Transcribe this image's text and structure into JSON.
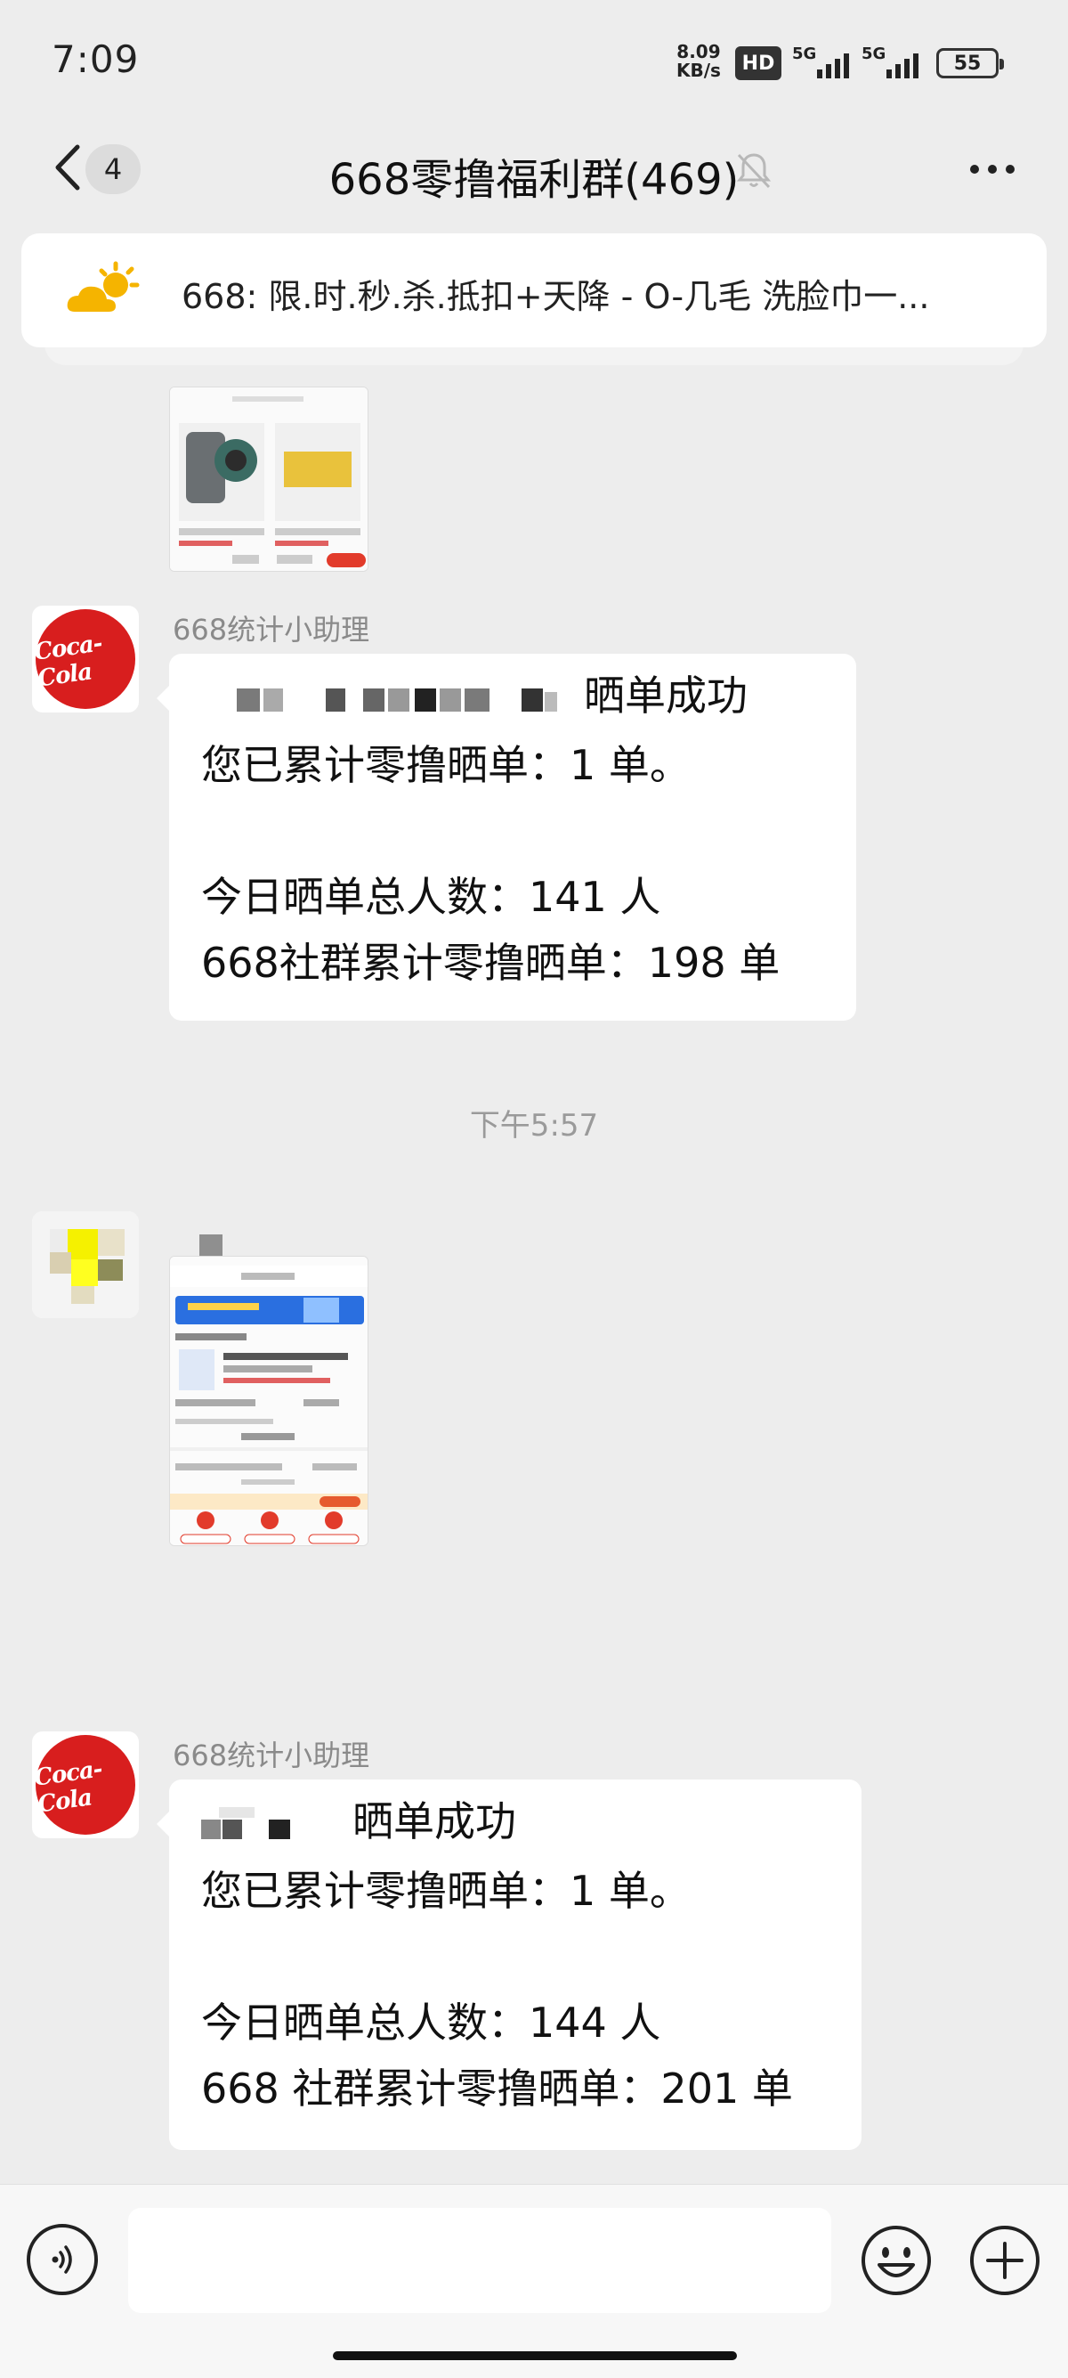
{
  "status_bar": {
    "time": "7:09",
    "net_speed_value": "8.09",
    "net_speed_unit": "KB/s",
    "hd_label": "HD",
    "signal_label_1": "5G",
    "signal_label_2": "5G",
    "battery": "55"
  },
  "header": {
    "back_count": "4",
    "title": "668零撸福利群(469)"
  },
  "announcement": {
    "text": "668: 限.时.秒.杀.抵扣+天降 - O-几毛  洗脸巾一..."
  },
  "messages": [
    {
      "sender": "668统计小助理",
      "line1_suffix": "晒单成功",
      "line2": "您已累计零撸晒单：1 单。",
      "line3": "今日晒单总人数：141 人",
      "line4": "668社群累计零撸晒单：198 单"
    },
    {
      "sender": "668统计小助理",
      "line1_suffix": "晒单成功",
      "line2": "您已累计零撸晒单：1 单。",
      "line3": "今日晒单总人数：144 人",
      "line4": "668 社群累计零撸晒单：201 单"
    }
  ],
  "timestamp": "下午5:57",
  "colors": {
    "coke_red": "#d81e1e",
    "chat_bg": "#ededed",
    "announce_icon": "#f5b400"
  }
}
